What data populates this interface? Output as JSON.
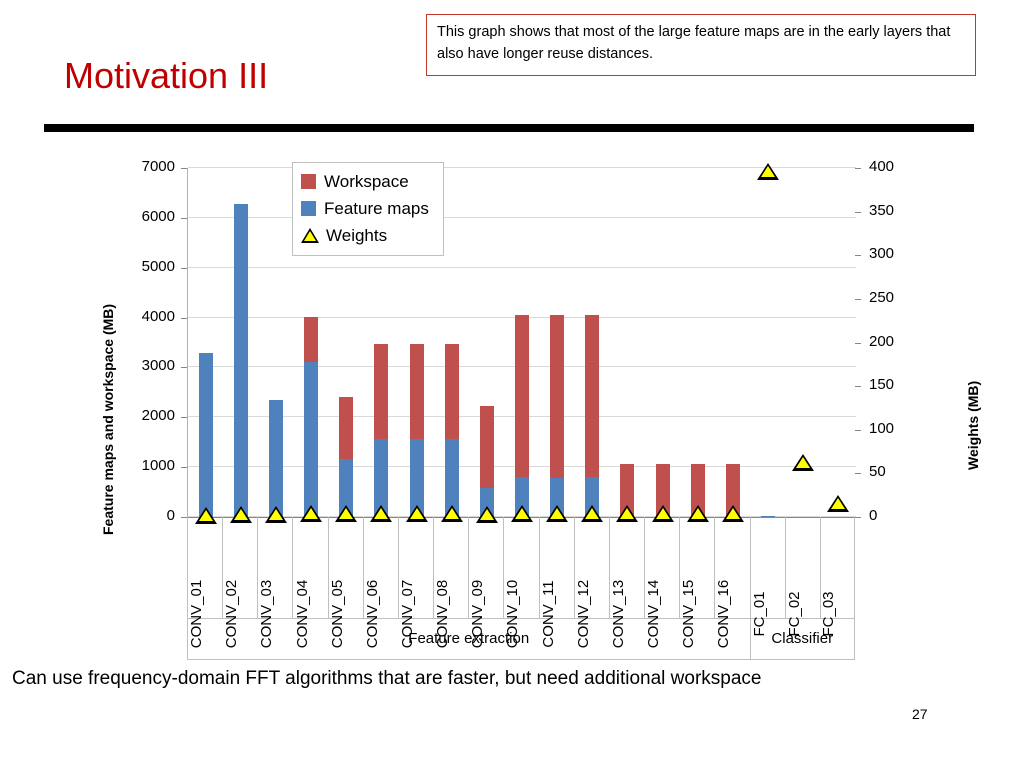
{
  "slide": {
    "title": "Motivation III",
    "callout_text": "This graph shows that most of the large feature maps are in the early layers that also have longer reuse distances.",
    "caption": "Can use frequency-domain FFT algorithms that are faster, but need additional workspace",
    "page_number": "27",
    "title_color": "#C00000",
    "callout_border_color": "#C0392B",
    "rule_color": "#000000"
  },
  "legend": {
    "position": "inside-top-left",
    "items": [
      {
        "label": "Workspace",
        "marker": "square-red",
        "color": "#C0504D"
      },
      {
        "label": "Feature maps",
        "marker": "square-blue",
        "color": "#4F81BD"
      },
      {
        "label": "Weights",
        "marker": "triangle-yellow",
        "color": "#FFFF00"
      }
    ]
  },
  "chart_data": {
    "type": "bar",
    "title": "",
    "subtitle": "",
    "xlabel": "",
    "ylabel": "Feature maps and workspace (MB)",
    "y2label": "Weights (MB)",
    "ylim": [
      0,
      7000
    ],
    "y2lim": [
      0,
      400
    ],
    "yticks": [
      0,
      1000,
      2000,
      3000,
      4000,
      5000,
      6000,
      7000
    ],
    "yticklabels": [
      "0",
      "1000",
      "2000",
      "3000",
      "4000",
      "5000",
      "6000",
      "7000"
    ],
    "y2ticks": [
      0,
      50,
      100,
      150,
      200,
      250,
      300,
      350,
      400
    ],
    "y2ticklabels": [
      "0",
      "50",
      "100",
      "150",
      "200",
      "250",
      "300",
      "350",
      "400"
    ],
    "grid": true,
    "grid_axis": "y",
    "stacked": true,
    "categories": [
      "CONV_01",
      "CONV_02",
      "CONV_03",
      "CONV_04",
      "CONV_05",
      "CONV_06",
      "CONV_07",
      "CONV_08",
      "CONV_09",
      "CONV_10",
      "CONV_11",
      "CONV_12",
      "CONV_13",
      "CONV_14",
      "CONV_15",
      "CONV_16",
      "FC_01",
      "FC_02",
      "FC_03"
    ],
    "groups": [
      {
        "label": "Feature extraction",
        "from": 0,
        "to": 15
      },
      {
        "label": "Classifier",
        "from": 16,
        "to": 18
      }
    ],
    "series": [
      {
        "name": "Feature maps",
        "axis": "left",
        "color": "#4F81BD",
        "values": [
          3280,
          6280,
          2350,
          3110,
          1165,
          1570,
          1565,
          1570,
          580,
          800,
          790,
          795,
          30,
          25,
          25,
          25,
          5,
          0,
          0
        ]
      },
      {
        "name": "Workspace",
        "axis": "left",
        "color": "#C0504D",
        "values": [
          0,
          0,
          0,
          900,
          1245,
          1910,
          1915,
          1910,
          1640,
          3250,
          3260,
          3255,
          1040,
          1045,
          1045,
          1045,
          0,
          0,
          0
        ]
      },
      {
        "name": "Weights",
        "axis": "right",
        "type": "scatter",
        "marker": "triangle",
        "color": "#FFFF00",
        "values": [
          1,
          2,
          2,
          3,
          3,
          4,
          4,
          4,
          2,
          3,
          3,
          3,
          4,
          4,
          4,
          4,
          395,
          62,
          15
        ]
      }
    ],
    "totals": [
      3280,
      6280,
      2350,
      4010,
      2410,
      3480,
      3480,
      3480,
      2220,
      4050,
      4050,
      4050,
      1070,
      1070,
      1070,
      1070,
      5,
      0,
      0
    ]
  }
}
